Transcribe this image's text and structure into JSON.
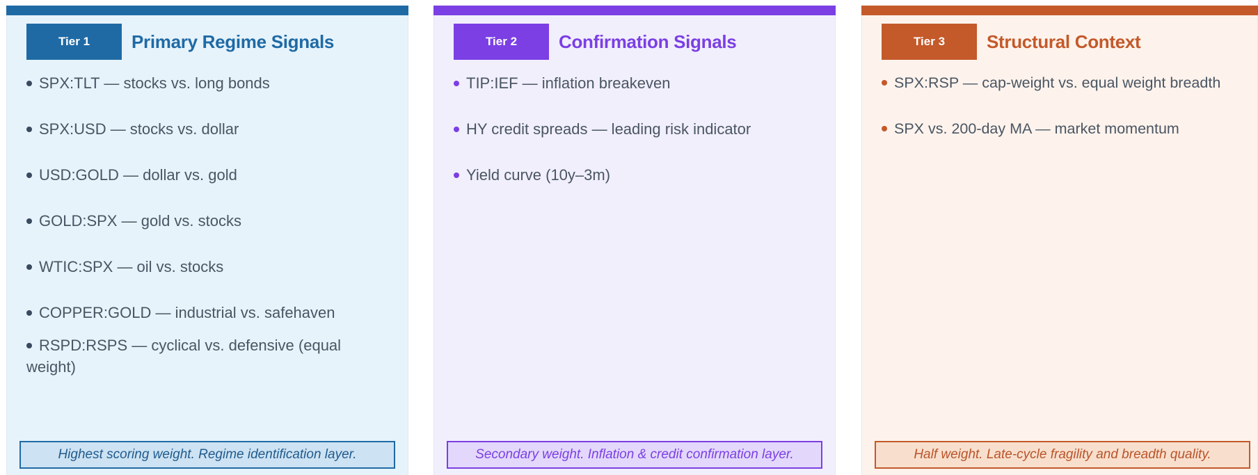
{
  "tiers": [
    {
      "badge": "Tier 1",
      "title": "Primary Regime Signals",
      "color": "#1f6aa5",
      "items": [
        "SPX:TLT — stocks vs. long bonds",
        "SPX:USD — stocks vs. dollar",
        "USD:GOLD — dollar vs. gold",
        "GOLD:SPX — gold vs. stocks",
        "WTIC:SPX — oil vs. stocks",
        "COPPER:GOLD — industrial vs. safehaven",
        "RSPD:RSPS — cyclical vs. defensive (equal weight)"
      ],
      "footer": "Highest scoring weight. Regime identification layer."
    },
    {
      "badge": "Tier 2",
      "title": "Confirmation Signals",
      "color": "#7b3fe4",
      "items": [
        "TIP:IEF — inflation breakeven",
        "HY credit spreads — leading risk indicator",
        "Yield curve (10y–3m)"
      ],
      "footer": "Secondary weight. Inflation & credit confirmation layer."
    },
    {
      "badge": "Tier 3",
      "title": "Structural Context",
      "color": "#c4592a",
      "items": [
        "SPX:RSP — cap-weight vs. equal weight breadth",
        "SPX vs. 200-day MA — market momentum"
      ],
      "footer": "Half weight. Late-cycle fragility and breadth quality."
    }
  ]
}
